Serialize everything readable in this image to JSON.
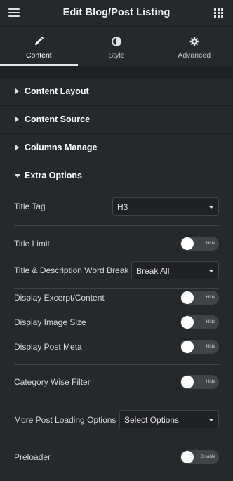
{
  "header": {
    "title": "Edit Blog/Post Listing",
    "menu_icon": "hamburger-menu-icon",
    "apps_icon": "grid-apps-icon"
  },
  "tabs": [
    {
      "label": "Content",
      "icon": "pencil-icon",
      "active": true
    },
    {
      "label": "Style",
      "icon": "half-circle-icon",
      "active": false
    },
    {
      "label": "Advanced",
      "icon": "gear-icon",
      "active": false
    }
  ],
  "sections": [
    {
      "label": "Content Layout",
      "open": false
    },
    {
      "label": "Content Source",
      "open": false
    },
    {
      "label": "Columns Manage",
      "open": false
    },
    {
      "label": "Extra Options",
      "open": true
    }
  ],
  "controls": {
    "title_tag": {
      "label": "Title Tag",
      "value": "H3"
    },
    "title_limit": {
      "label": "Title Limit",
      "toggle": "Hide"
    },
    "word_break": {
      "label": "Title & Description Word Break",
      "value": "Break All"
    },
    "display_excerpt": {
      "label": "Display Excerpt/Content",
      "toggle": "Hide"
    },
    "display_image_size": {
      "label": "Display Image Size",
      "toggle": "Hide"
    },
    "display_post_meta": {
      "label": "Display Post Meta",
      "toggle": "Hide"
    },
    "category_filter": {
      "label": "Category Wise Filter",
      "toggle": "Hide"
    },
    "more_post_loading": {
      "label": "More Post Loading Options",
      "value": "Select Options"
    },
    "preloader": {
      "label": "Preloader",
      "toggle": "Disable"
    }
  },
  "colors": {
    "panel_bg": "#26292c",
    "input_bg": "#1f2124",
    "border": "#3f4347",
    "toggle_off": "#3f4448",
    "text": "#e0e1e3"
  }
}
